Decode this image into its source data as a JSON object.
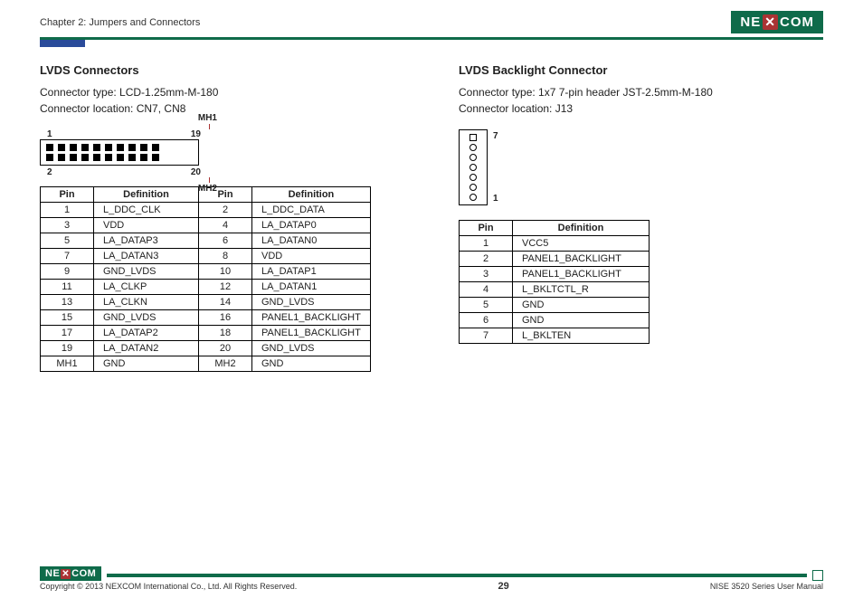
{
  "header": {
    "chapter": "Chapter 2: Jumpers and Connectors",
    "brand_a": "NE",
    "brand_b": "COM"
  },
  "left": {
    "title": "LVDS Connectors",
    "type": "Connector type: LCD-1.25mm-M-180",
    "location": "Connector location: CN7, CN8",
    "diagram": {
      "tl": "1",
      "tr": "19",
      "bl": "2",
      "br": "20",
      "mh1": "MH1",
      "mh2": "MH2"
    },
    "th": {
      "pin": "Pin",
      "def": "Definition"
    },
    "rows": [
      {
        "p1": "1",
        "d1": "L_DDC_CLK",
        "p2": "2",
        "d2": "L_DDC_DATA"
      },
      {
        "p1": "3",
        "d1": "VDD",
        "p2": "4",
        "d2": "LA_DATAP0"
      },
      {
        "p1": "5",
        "d1": "LA_DATAP3",
        "p2": "6",
        "d2": "LA_DATAN0"
      },
      {
        "p1": "7",
        "d1": "LA_DATAN3",
        "p2": "8",
        "d2": "VDD"
      },
      {
        "p1": "9",
        "d1": "GND_LVDS",
        "p2": "10",
        "d2": "LA_DATAP1"
      },
      {
        "p1": "11",
        "d1": "LA_CLKP",
        "p2": "12",
        "d2": "LA_DATAN1"
      },
      {
        "p1": "13",
        "d1": "LA_CLKN",
        "p2": "14",
        "d2": "GND_LVDS"
      },
      {
        "p1": "15",
        "d1": "GND_LVDS",
        "p2": "16",
        "d2": "PANEL1_BACKLIGHT"
      },
      {
        "p1": "17",
        "d1": "LA_DATAP2",
        "p2": "18",
        "d2": "PANEL1_BACKLIGHT"
      },
      {
        "p1": "19",
        "d1": "LA_DATAN2",
        "p2": "20",
        "d2": "GND_LVDS"
      },
      {
        "p1": "MH1",
        "d1": "GND",
        "p2": "MH2",
        "d2": "GND"
      }
    ]
  },
  "right": {
    "title": "LVDS Backlight Connector",
    "type": "Connector type: 1x7 7-pin header JST-2.5mm-M-180",
    "location": "Connector location: J13",
    "diagram": {
      "top": "7",
      "bot": "1"
    },
    "th": {
      "pin": "Pin",
      "def": "Definition"
    },
    "rows": [
      {
        "p": "1",
        "d": "VCC5"
      },
      {
        "p": "2",
        "d": "PANEL1_BACKLIGHT"
      },
      {
        "p": "3",
        "d": "PANEL1_BACKLIGHT"
      },
      {
        "p": "4",
        "d": "L_BKLTCTL_R"
      },
      {
        "p": "5",
        "d": "GND"
      },
      {
        "p": "6",
        "d": "GND"
      },
      {
        "p": "7",
        "d": "L_BKLTEN"
      }
    ]
  },
  "footer": {
    "copyright": "Copyright © 2013 NEXCOM International Co., Ltd. All Rights Reserved.",
    "page": "29",
    "manual": "NISE 3520 Series User Manual"
  }
}
